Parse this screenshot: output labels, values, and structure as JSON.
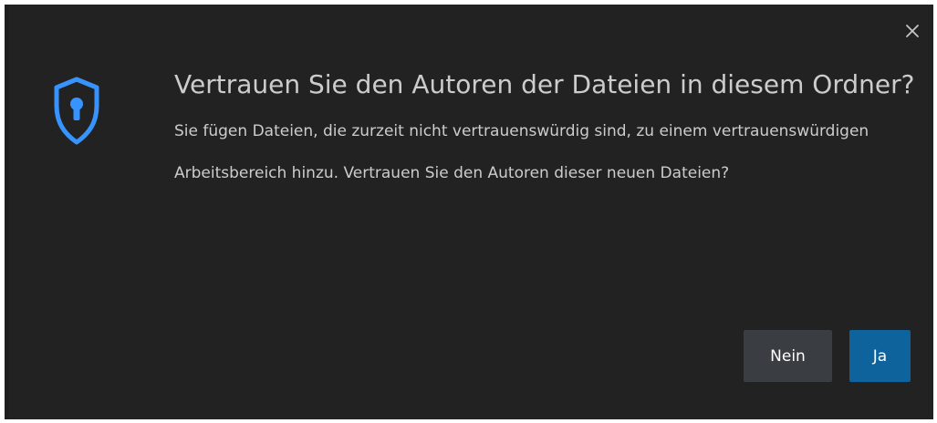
{
  "dialog": {
    "title": "Vertrauen Sie den Autoren der Dateien in diesem Ordner?",
    "message": "Sie fügen Dateien, die zurzeit nicht vertrauenswürdig sind, zu einem vertrauenswürdigen Arbeitsbereich hinzu. Vertrauen Sie den Autoren dieser neuen Dateien?",
    "close_icon": "close-icon",
    "shield_icon": "shield-lock-icon",
    "buttons": {
      "no_label": "Nein",
      "yes_label": "Ja"
    }
  },
  "colors": {
    "dialog_background": "#222222",
    "text": "#cccccc",
    "accent": "#3794ff",
    "primary_button": "#0e639c",
    "secondary_button": "#3a3d41"
  }
}
